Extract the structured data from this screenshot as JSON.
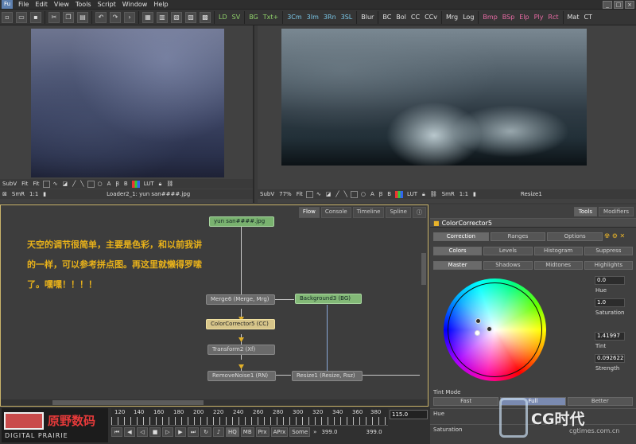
{
  "menu": {
    "logo": "Fu",
    "items": [
      "File",
      "Edit",
      "View",
      "Tools",
      "Script",
      "Window",
      "Help"
    ]
  },
  "toolbar": {
    "green_tools": [
      "LD",
      "SV"
    ],
    "mid_tools": [
      "BG",
      "Txt+"
    ],
    "cyan_tools": [
      "3Cm",
      "3Im",
      "3Rn",
      "3SL"
    ],
    "white_tools": [
      "Blur",
      "BC",
      "Bol",
      "CC",
      "CCv",
      "Mrg",
      "Log"
    ],
    "pink_tools": [
      "Bmp",
      "BSp",
      "Elp",
      "Ply",
      "Rct"
    ],
    "end_tools": [
      "Mat",
      "CT"
    ]
  },
  "viewer_left": {
    "subv": "SubV",
    "fit1": "Fit",
    "fit2": "Fit",
    "smr": "SmR",
    "ratio": "1:1",
    "lut": "LUT",
    "label": "Loader2_1: yun san####.jpg"
  },
  "viewer_right": {
    "subv": "SubV",
    "zoom": "77%",
    "fit": "Fit",
    "lut": "LUT",
    "smr": "SmR",
    "ratio": "1:1",
    "label": "Resize1"
  },
  "flow": {
    "tabs": [
      "Flow",
      "Console",
      "Timeline",
      "Spline"
    ],
    "note": "天空的调节很简单，主要是色彩，和以前我讲的一样，可以参考拼点图。再这里就懒得罗嗦了。嘿嘿！！！！",
    "nodes": {
      "loader": "yun san####.jpg",
      "merge": "Merge6 (Merge, Mrg)",
      "background": "Background3 (BG)",
      "cc": "ColorCorrector5 (CC)",
      "transform": "Transform2 (Xf)",
      "removenoise": "RemoveNoise1 (RN)",
      "resize": "Resize1 (Resize, Rsz)"
    }
  },
  "panel": {
    "tabs": [
      "Tools",
      "Modifiers"
    ],
    "title": "ColorCorrector5",
    "subtabs": [
      "Correction",
      "Ranges",
      "Options"
    ],
    "mode_buttons": [
      "Colors",
      "Levels",
      "Histogram",
      "Suppress"
    ],
    "range_buttons": [
      "Master",
      "Shadows",
      "Midtones",
      "Highlights"
    ],
    "hue_value": "0.0",
    "hue_label": "Hue",
    "sat_value": "1.0",
    "sat_label": "Saturation",
    "tint_value": "1.41997",
    "tint_label": "Tint",
    "strength_value": "0.092622",
    "strength_label": "Strength",
    "tint_mode_label": "Tint Mode",
    "tint_modes": [
      "Fast",
      "Full",
      "Better"
    ],
    "slider_hue": "Hue",
    "slider_sat": "Saturation"
  },
  "timeline": {
    "brand_cn": "原野数码",
    "brand_en": "DIGITAL PRAIRIE",
    "ticks": [
      "120",
      "140",
      "160",
      "180",
      "200",
      "220",
      "240",
      "260",
      "280",
      "300",
      "320",
      "340",
      "360",
      "380"
    ],
    "current": "115.0",
    "controls": [
      "HQ",
      "MB",
      "Prx",
      "APrx",
      "Some"
    ],
    "range_start": "399.0",
    "range_end": "399.0"
  },
  "watermark": {
    "title": "CG时代",
    "url": "cgtimes.com.cn"
  }
}
